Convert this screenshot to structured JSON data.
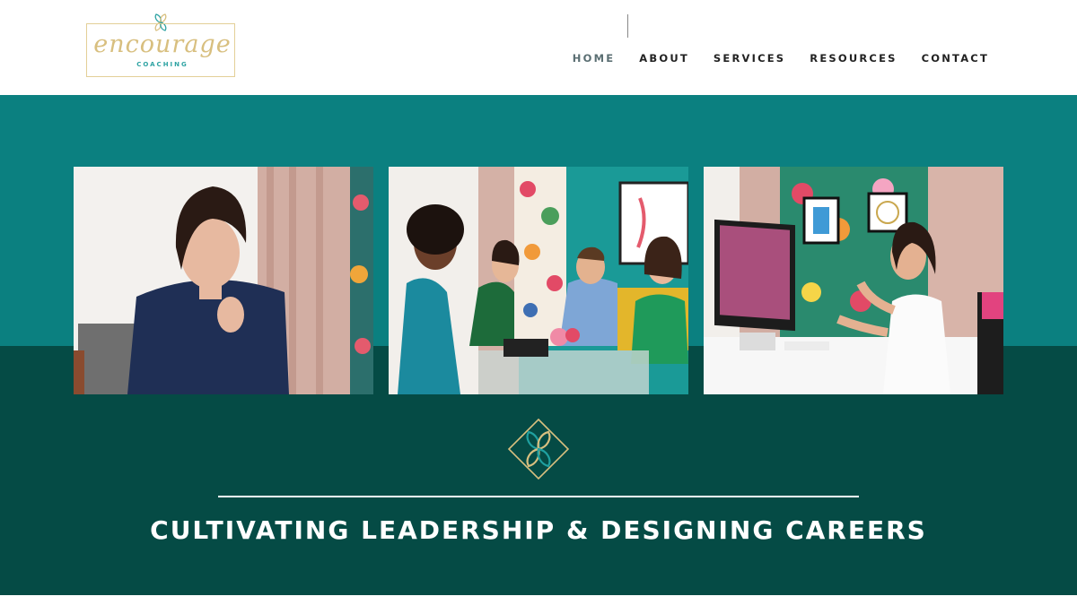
{
  "logo": {
    "script_text": "encourage",
    "sub_text": "COACHING"
  },
  "nav": {
    "items": [
      {
        "label": "HOME",
        "active": true
      },
      {
        "label": "ABOUT",
        "active": false
      },
      {
        "label": "SERVICES",
        "active": false
      },
      {
        "label": "RESOURCES",
        "active": false
      },
      {
        "label": "CONTACT",
        "active": false
      }
    ]
  },
  "hero": {
    "headline": "CULTIVATING LEADERSHIP & DESIGNING CAREERS",
    "emblem_icon": "four-leaf-diamond-icon"
  },
  "colors": {
    "teal": "#0b8080",
    "dark_teal": "#054b45",
    "gold": "#d8bf7f",
    "white": "#ffffff"
  }
}
